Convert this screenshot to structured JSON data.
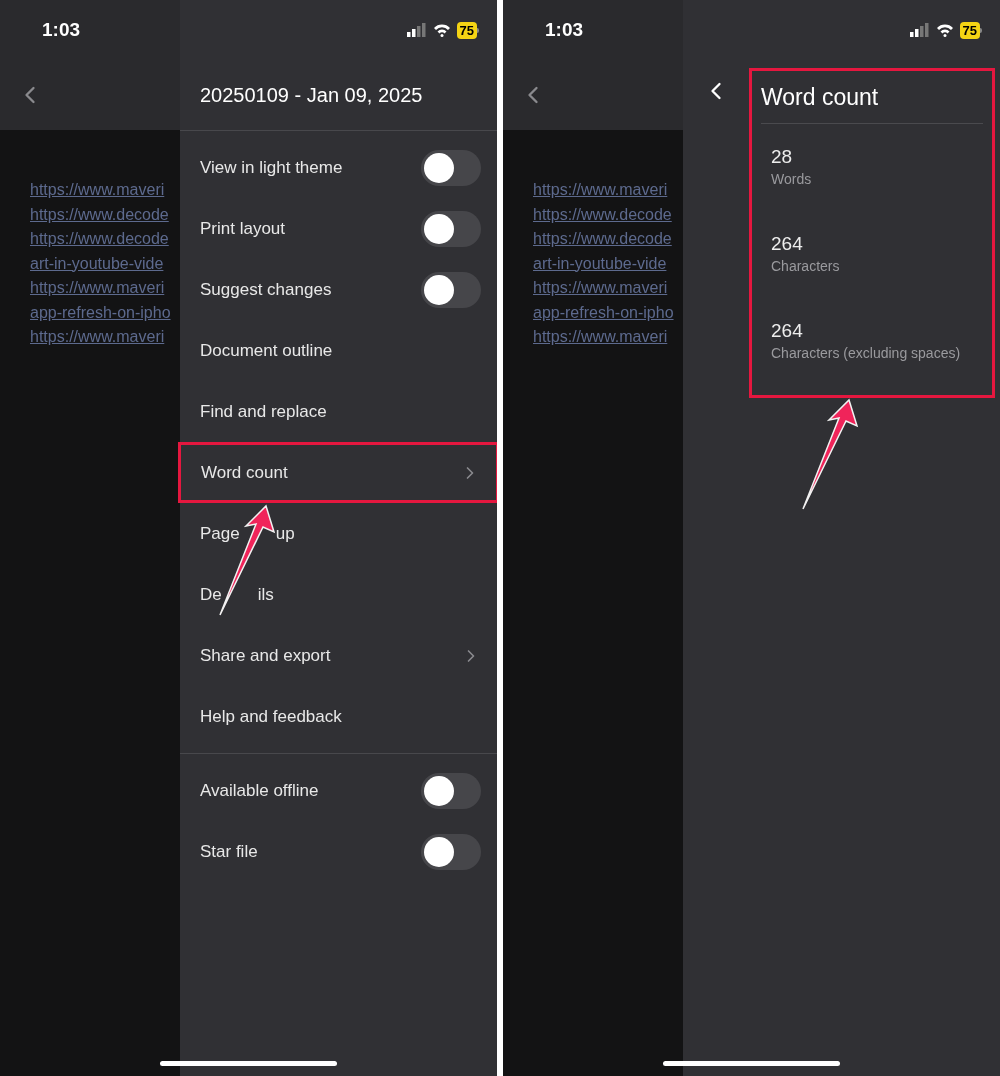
{
  "phones": [
    {
      "status": {
        "time": "1:03",
        "battery": "75"
      },
      "document": {
        "links": [
          "https://www.maveri",
          "https://www.decode",
          "https://www.decode",
          "art-in-youtube-vide",
          "https://www.maveri",
          "app-refresh-on-ipho",
          "https://www.maveri"
        ]
      },
      "panel": {
        "kind": "menu",
        "title": "20250109 - Jan 09, 2025",
        "sections": [
          [
            {
              "label": "View in light theme",
              "kind": "toggle",
              "on": false,
              "highlighted": false
            },
            {
              "label": "Print layout",
              "kind": "toggle",
              "on": false,
              "highlighted": false
            },
            {
              "label": "Suggest changes",
              "kind": "toggle",
              "on": false,
              "highlighted": false
            },
            {
              "label": "Document outline",
              "kind": "action",
              "highlighted": false
            },
            {
              "label": "Find and replace",
              "kind": "action",
              "highlighted": false
            },
            {
              "label": "Word count",
              "kind": "submenu",
              "highlighted": true
            },
            {
              "label_parts": [
                "Page",
                "up"
              ],
              "kind": "action",
              "highlighted": false
            },
            {
              "label_parts": [
                "De",
                "ils"
              ],
              "kind": "action",
              "highlighted": false
            },
            {
              "label": "Share and export",
              "kind": "submenu",
              "highlighted": false
            },
            {
              "label": "Help and feedback",
              "kind": "action",
              "highlighted": false
            }
          ],
          [
            {
              "label": "Available offline",
              "kind": "toggle",
              "on": false,
              "highlighted": false
            },
            {
              "label": "Star file",
              "kind": "toggle",
              "on": false,
              "highlighted": false
            }
          ]
        ]
      }
    },
    {
      "status": {
        "time": "1:03",
        "battery": "75"
      },
      "document": {
        "links": [
          "https://www.maveri",
          "https://www.decode",
          "https://www.decode",
          "art-in-youtube-vide",
          "https://www.maveri",
          "app-refresh-on-ipho",
          "https://www.maveri"
        ]
      },
      "panel": {
        "kind": "word_count",
        "title": "Word count",
        "highlighted": true,
        "stats": [
          {
            "value": "28",
            "label": "Words"
          },
          {
            "value": "264",
            "label": "Characters"
          },
          {
            "value": "264",
            "label": "Characters (excluding spaces)"
          }
        ]
      }
    }
  ]
}
